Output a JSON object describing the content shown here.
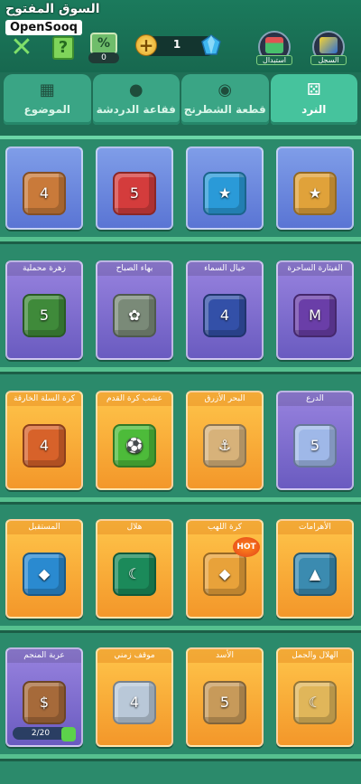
{
  "watermark": {
    "arabic": "السوق المفتوح",
    "latin": "OpenSooq"
  },
  "header": {
    "percent_label": "%",
    "percent_count": "0",
    "gem_count": "1",
    "market_label": "استبدال",
    "record_label": "السجل"
  },
  "tabs": [
    {
      "label": "النرد",
      "icon": "dice-icon",
      "active": true
    },
    {
      "label": "قطعة الشطرنج",
      "icon": "chess-piece-icon",
      "active": false
    },
    {
      "label": "فقاعة الدردشة",
      "icon": "chat-bubble-icon",
      "active": false
    },
    {
      "label": "الموضوع",
      "icon": "theme-grid-icon",
      "active": false
    }
  ],
  "rows": [
    {
      "cards": [
        {
          "title": "",
          "style": "blue",
          "die_color": "#e0a23a",
          "face": "★"
        },
        {
          "title": "",
          "style": "blue",
          "die_color": "#2a9ad8",
          "face": "★"
        },
        {
          "title": "",
          "style": "blue",
          "die_color": "#d43c3c",
          "face": "5"
        },
        {
          "title": "",
          "style": "blue",
          "die_color": "#c97a3a",
          "face": "4"
        }
      ]
    },
    {
      "cards": [
        {
          "title": "الفيتارة الساحرة",
          "style": "purple",
          "die_color": "#6a3ea8",
          "face": "M"
        },
        {
          "title": "خيال السماء",
          "style": "purple",
          "die_color": "#3350a8",
          "face": "4"
        },
        {
          "title": "بهاء الصباح",
          "style": "purple",
          "die_color": "#7a8a78",
          "face": "✿"
        },
        {
          "title": "زهرة محملية",
          "style": "purple",
          "die_color": "#3f8a3a",
          "face": "5"
        }
      ]
    },
    {
      "cards": [
        {
          "title": "الدرع",
          "style": "purple",
          "die_color": "#9fb8e8",
          "face": "5"
        },
        {
          "title": "البحر الأزرق",
          "style": "orange",
          "die_color": "#d7b27a",
          "face": "⚓"
        },
        {
          "title": "عشب كرة القدم",
          "style": "orange",
          "die_color": "#4dbb3a",
          "face": "⚽"
        },
        {
          "title": "كرة السلة الخارقة",
          "style": "orange",
          "die_color": "#d7622a",
          "face": "4"
        }
      ]
    },
    {
      "cards": [
        {
          "title": "الأهرامات",
          "style": "orange",
          "die_color": "#3b8bb0",
          "face": "▲"
        },
        {
          "title": "كرة اللهب",
          "style": "orange",
          "die_color": "#e8a23a",
          "face": "◆",
          "hot": "HOT"
        },
        {
          "title": "هلال",
          "style": "orange",
          "die_color": "#1b8a5a",
          "face": "☾"
        },
        {
          "title": "المستقبل",
          "style": "orange",
          "die_color": "#2a8ad0",
          "face": "◆"
        }
      ]
    },
    {
      "cards": [
        {
          "title": "الهلال والجمل",
          "style": "orange",
          "die_color": "#e0b65a",
          "face": "☾"
        },
        {
          "title": "الأسد",
          "style": "orange",
          "die_color": "#c79a5a",
          "face": "5"
        },
        {
          "title": "موقف زمني",
          "style": "orange",
          "die_color": "#b9c8d8",
          "face": "4"
        },
        {
          "title": "عربة المنجم",
          "style": "purple",
          "die_color": "#a66a3a",
          "face": "$",
          "progress": "2/20"
        }
      ]
    }
  ]
}
